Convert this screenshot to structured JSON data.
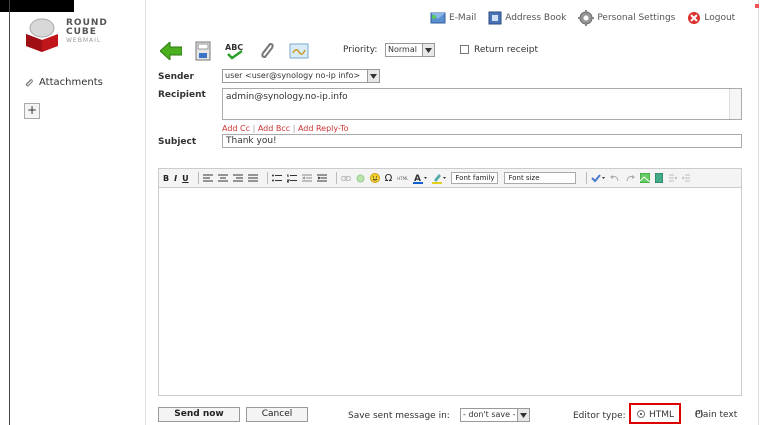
{
  "logo": {
    "line1": "ROUND",
    "line2": "CUBE",
    "line3": "WEBMAIL"
  },
  "topnav": {
    "email": "E-Mail",
    "addressbook": "Address Book",
    "settings": "Personal Settings",
    "logout": "Logout"
  },
  "sidebar": {
    "attachments": "Attachments",
    "add": "+"
  },
  "compose": {
    "priority_label": "Priority:",
    "priority_value": "Normal",
    "receipt_label": "Return receipt",
    "sender_label": "Sender",
    "sender_value": "user <user@synology no-ip info>",
    "recipient_label": "Recipient",
    "recipient_value": "admin@synology.no-ip.info",
    "add_cc": "Add Cc",
    "add_bcc": "Add Bcc",
    "add_replyto": "Add Reply-To",
    "sep": "|",
    "subject_label": "Subject",
    "subject_value": "Thank you!"
  },
  "editor_toolbar": {
    "bold": "B",
    "italic": "I",
    "underline": "U",
    "omega": "Ω",
    "html": "HTML",
    "font_family": "Font family",
    "font_size": "Font size"
  },
  "footer": {
    "send": "Send now",
    "cancel": "Cancel",
    "save_label": "Save sent message in:",
    "save_value": "- don't save -",
    "editor_type_label": "Editor type:",
    "html_label": "HTML",
    "plain_label": "Plain text"
  },
  "colors": {
    "accent_red": "#d00000",
    "link_red": "#cc3333"
  }
}
